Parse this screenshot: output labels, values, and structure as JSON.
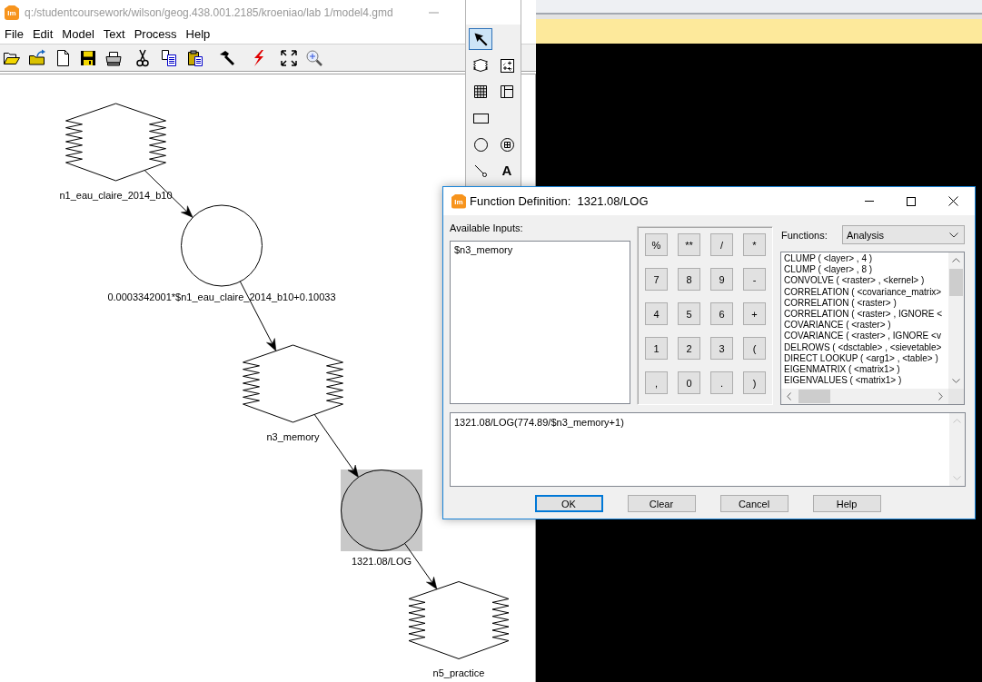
{
  "model_window": {
    "logo": "Im",
    "title": "q:/studentcoursework/wilson/geog.438.001.2185/kroeniao/lab 1/model4.gmd",
    "menu": [
      "File",
      "Edit",
      "Model",
      "Text",
      "Process",
      "Help"
    ]
  },
  "tool_palette": {
    "tools": [
      {
        "kind": "pointer",
        "selected": true
      },
      {
        "kind": "raster",
        "selected": false
      },
      {
        "kind": "vector",
        "selected": false
      },
      {
        "kind": "matrix",
        "selected": false
      },
      {
        "kind": "table",
        "selected": false
      },
      {
        "kind": "scalar",
        "selected": false
      },
      {
        "kind": "function",
        "selected": false
      },
      {
        "kind": "criteria",
        "selected": false
      },
      {
        "kind": "connect",
        "selected": false
      },
      {
        "kind": "text",
        "label": "A",
        "selected": false
      }
    ]
  },
  "canvas": {
    "nodes": [
      {
        "kind": "raster",
        "label": "n1_eau_claire_2014_b10",
        "selected": false
      },
      {
        "kind": "function",
        "label": "0.0003342001*$n1_eau_claire_2014_b10+0.10033",
        "selected": false
      },
      {
        "kind": "raster",
        "label": "n3_memory",
        "selected": false
      },
      {
        "kind": "function",
        "label": "1321.08/LOG",
        "selected": true
      },
      {
        "kind": "raster",
        "label": "n5_practice",
        "selected": false
      }
    ]
  },
  "dialog": {
    "logo": "Im",
    "title": "Function Definition:  1321.08/LOG",
    "inputs_label": "Available Inputs:",
    "inputs": [
      {
        "label": "$n3_memory",
        "selected": false
      }
    ],
    "keypad": [
      "%",
      "**",
      "/",
      "*",
      "7",
      "8",
      "9",
      "-",
      "4",
      "5",
      "6",
      "+",
      "1",
      "2",
      "3",
      "(",
      ",",
      "0",
      ".",
      ")"
    ],
    "functions_label": "Functions:",
    "category": "Analysis",
    "functions": [
      {
        "label": "CLUMP ( <layer> , 4 )",
        "selected": false
      },
      {
        "label": "CLUMP ( <layer> , 8 )",
        "selected": false
      },
      {
        "label": "CONVOLVE ( <raster> , <kernel> )",
        "selected": false
      },
      {
        "label": "CORRELATION ( <covariance_matrix>",
        "selected": false
      },
      {
        "label": "CORRELATION ( <raster> )",
        "selected": false
      },
      {
        "label": "CORRELATION ( <raster> , IGNORE <",
        "selected": false
      },
      {
        "label": "COVARIANCE ( <raster> )",
        "selected": false
      },
      {
        "label": "COVARIANCE ( <raster> , IGNORE <v",
        "selected": false
      },
      {
        "label": "DELROWS ( <dsctable> , <sievetable>",
        "selected": false
      },
      {
        "label": "DIRECT LOOKUP ( <arg1> , <table> )",
        "selected": false
      },
      {
        "label": "EIGENMATRIX ( <matrix1> )",
        "selected": false
      },
      {
        "label": "EIGENVALUES ( <matrix1> )",
        "selected": false
      }
    ],
    "expression": "1321.08/LOG(774.89/$n3_memory+1)",
    "buttons": [
      {
        "label": "OK",
        "default": true
      },
      {
        "label": "Clear",
        "default": false
      },
      {
        "label": "Cancel",
        "default": false
      },
      {
        "label": "Help",
        "default": false
      }
    ]
  }
}
